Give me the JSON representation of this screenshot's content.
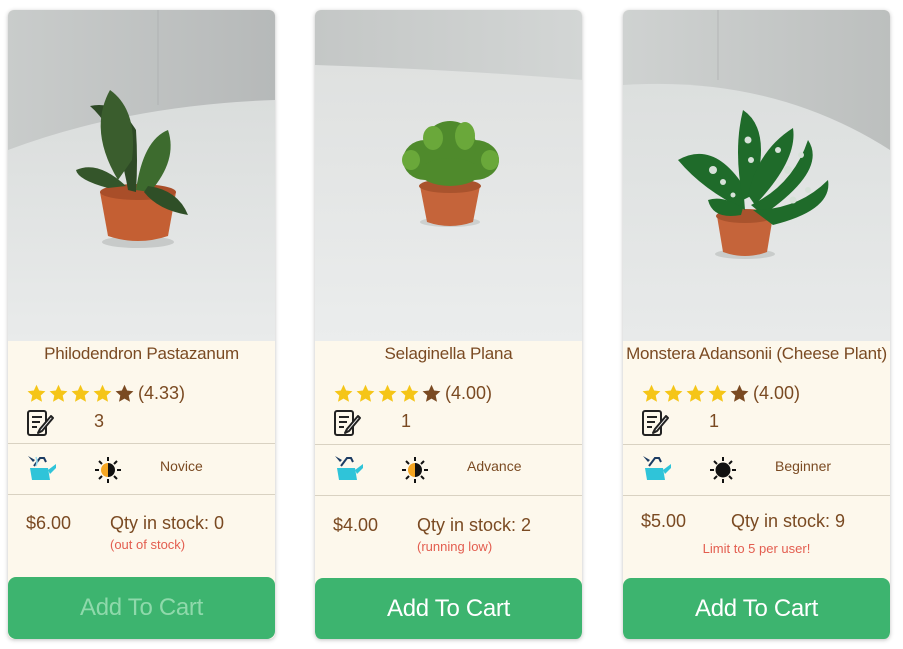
{
  "products": [
    {
      "name": "Philodendron Pastazanum",
      "rating": 4.33,
      "rating_text": "(4.33)",
      "stars": [
        "full",
        "full",
        "full",
        "full",
        "dark"
      ],
      "reviews": "3",
      "care_level": "Novice",
      "sun_icon": "partial-sun-icon",
      "price": "$6.00",
      "qty": "Qty in stock: 0",
      "note": "(out of stock)",
      "button": "Add To Cart",
      "button_disabled": true
    },
    {
      "name": "Selaginella Plana",
      "rating": 4.0,
      "rating_text": "(4.00)",
      "stars": [
        "full",
        "full",
        "full",
        "full",
        "dark"
      ],
      "reviews": "1",
      "care_level": "Advance",
      "sun_icon": "partial-sun-icon",
      "price": "$4.00",
      "qty": "Qty in stock: 2",
      "note": "(running low)",
      "button": "Add To Cart",
      "button_disabled": false
    },
    {
      "name": "Monstera Adansonii (Cheese Plant)",
      "rating": 4.0,
      "rating_text": "(4.00)",
      "stars": [
        "full",
        "full",
        "full",
        "full",
        "dark"
      ],
      "reviews": "1",
      "care_level": "Beginner",
      "sun_icon": "full-sun-icon",
      "price": "$5.00",
      "qty": "Qty in stock: 9",
      "note": "Limit to 5 per user!",
      "button": "Add To Cart",
      "button_disabled": false
    }
  ],
  "colors": {
    "accent_green": "#3db46f",
    "text_brown": "#7a4a22",
    "warning_red": "#e35d4f",
    "card_bg": "#fdf8ec",
    "star_gold": "#f5c518",
    "star_dark": "#7a4a22"
  }
}
